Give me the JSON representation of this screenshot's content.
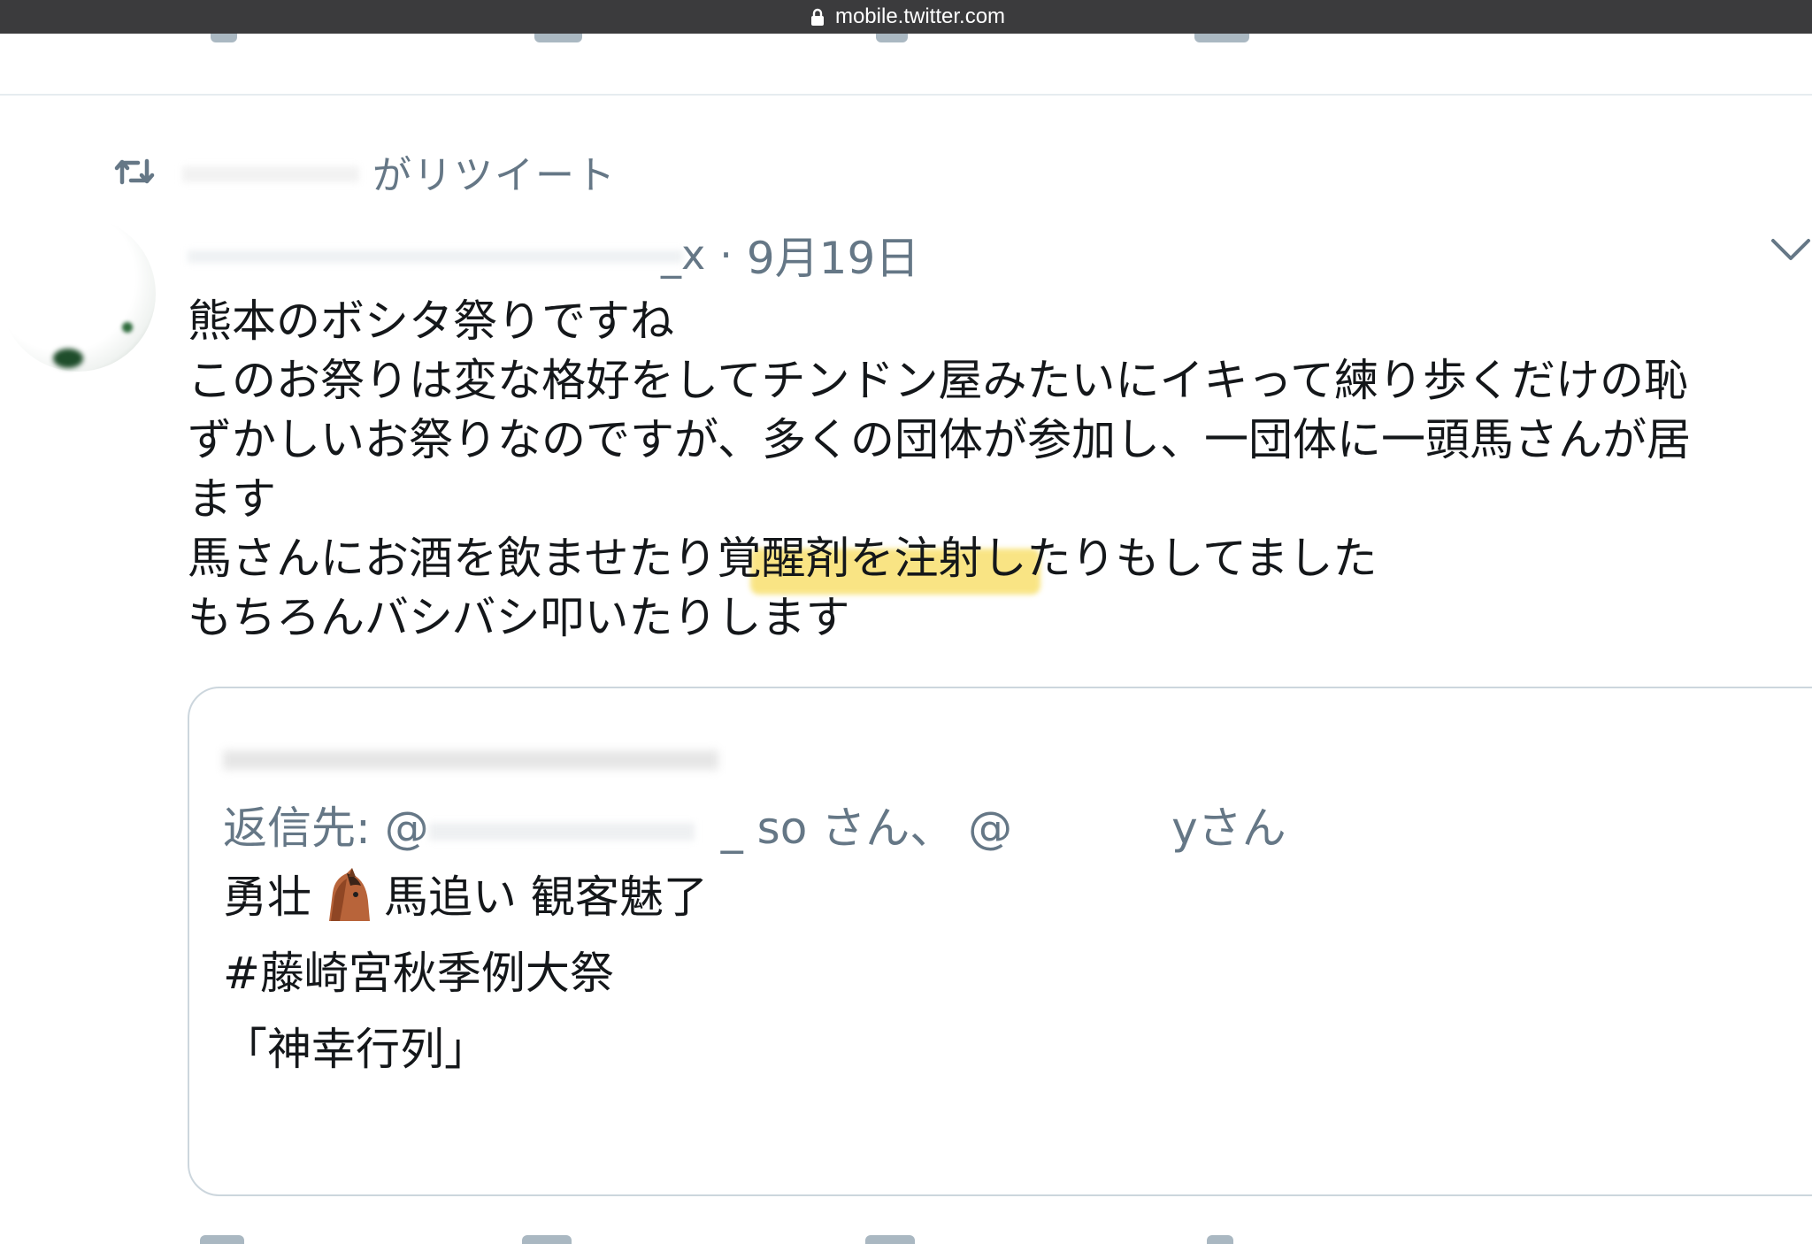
{
  "browser": {
    "url": "mobile.twitter.com",
    "lock_icon": "lock-icon"
  },
  "retweet_banner": {
    "icon": "retweet-icon",
    "text": "がリツイート"
  },
  "tweet": {
    "handle_suffix": "_x",
    "separator": "·",
    "date": "9月19日",
    "lines": [
      "熊本のボシタ祭りですね",
      "このお祭りは変な格好をしてチンドン屋みたいにイキって練り歩くだけの恥",
      "ずかしいお祭りなのですが、多くの団体が参加し、一団体に一頭馬さんが居",
      "ます",
      "馬さんにお酒を飲ませたり覚醒剤を注射したりもしてました",
      "もちろんバシバシ叩いたりします"
    ],
    "highlight_color": "#f7dc5c",
    "menu_icon": "chevron-down-icon"
  },
  "quoted_tweet": {
    "reply_prefix": "返信先: @",
    "reply_mention_1_suffix": "_",
    "reply_mention_1_end": "so さん、 @",
    "reply_mention_2_end": "yさん",
    "line_1_before_emoji": "勇壮",
    "emoji": "horse-face-icon",
    "line_1_after_emoji": "馬追い 観客魅了",
    "hashtag": "#藤崎宮秋季例大祭",
    "line_3": "「神幸行列」"
  },
  "colors": {
    "text": "#14171a",
    "secondary": "#657786",
    "border": "#ccd6dd",
    "urlbar": "#3b3b3d"
  }
}
